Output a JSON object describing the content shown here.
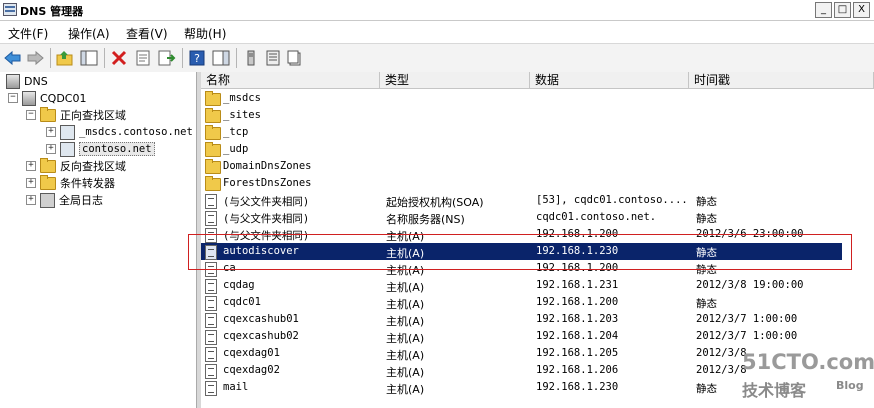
{
  "window": {
    "title": "DNS 管理器",
    "buttons": [
      "_",
      "□",
      "X"
    ]
  },
  "menu": [
    "文件(F)",
    "操作(A)",
    "查看(V)",
    "帮助(H)"
  ],
  "toolbar": [
    {
      "name": "back-arrow-icon"
    },
    {
      "name": "forward-arrow-icon"
    },
    {
      "name": "up-folder-icon"
    },
    {
      "name": "show-hide-tree-icon"
    },
    {
      "name": "delete-icon"
    },
    {
      "name": "properties-icon"
    },
    {
      "name": "export-list-icon"
    },
    {
      "name": "help-icon"
    },
    {
      "name": "show-action-pane-icon"
    },
    {
      "name": "server-icon"
    },
    {
      "name": "list-view-icon"
    },
    {
      "name": "zone-icon"
    }
  ],
  "tree": {
    "root": "DNS",
    "server": "CQDC01",
    "forward_zones": "正向查找区域",
    "zone_msdcs": "_msdcs.contoso.net",
    "zone_contoso": "contoso.net",
    "reverse_zones": "反向查找区域",
    "forwarders": "条件转发器",
    "global_logs": "全局日志"
  },
  "table": {
    "columns": [
      "名称",
      "类型",
      "数据",
      "时间戳"
    ],
    "rows": [
      {
        "icon": "folder",
        "name": "_msdcs",
        "type": "",
        "data": "",
        "time": ""
      },
      {
        "icon": "folder",
        "name": "_sites",
        "type": "",
        "data": "",
        "time": ""
      },
      {
        "icon": "folder",
        "name": "_tcp",
        "type": "",
        "data": "",
        "time": ""
      },
      {
        "icon": "folder",
        "name": "_udp",
        "type": "",
        "data": "",
        "time": ""
      },
      {
        "icon": "folder",
        "name": "DomainDnsZones",
        "type": "",
        "data": "",
        "time": ""
      },
      {
        "icon": "folder",
        "name": "ForestDnsZones",
        "type": "",
        "data": "",
        "time": ""
      },
      {
        "icon": "record",
        "name": "(与父文件夹相同)",
        "type": "起始授权机构(SOA)",
        "data": "[53], cqdc01.contoso....",
        "time": "静态"
      },
      {
        "icon": "record",
        "name": "(与父文件夹相同)",
        "type": "名称服务器(NS)",
        "data": "cqdc01.contoso.net.",
        "time": "静态"
      },
      {
        "icon": "record",
        "name": "(与父文件夹相同)",
        "type": "主机(A)",
        "data": "192.168.1.200",
        "time": "2012/3/6 23:00:00"
      },
      {
        "icon": "record",
        "name": "autodiscover",
        "type": "主机(A)",
        "data": "192.168.1.230",
        "time": "静态"
      },
      {
        "icon": "record",
        "name": "ca",
        "type": "主机(A)",
        "data": "192.168.1.200",
        "time": "静态"
      },
      {
        "icon": "record",
        "name": "cqdag",
        "type": "主机(A)",
        "data": "192.168.1.231",
        "time": "2012/3/8 19:00:00"
      },
      {
        "icon": "record",
        "name": "cqdc01",
        "type": "主机(A)",
        "data": "192.168.1.200",
        "time": "静态"
      },
      {
        "icon": "record",
        "name": "cqexcashub01",
        "type": "主机(A)",
        "data": "192.168.1.203",
        "time": "2012/3/7 1:00:00"
      },
      {
        "icon": "record",
        "name": "cqexcashub02",
        "type": "主机(A)",
        "data": "192.168.1.204",
        "time": "2012/3/7 1:00:00"
      },
      {
        "icon": "record",
        "name": "cqexdag01",
        "type": "主机(A)",
        "data": "192.168.1.205",
        "time": "2012/3/8"
      },
      {
        "icon": "record",
        "name": "cqexdag02",
        "type": "主机(A)",
        "data": "192.168.1.206",
        "time": "2012/3/8"
      },
      {
        "icon": "record",
        "name": "mail",
        "type": "主机(A)",
        "data": "192.168.1.230",
        "time": "静态"
      }
    ],
    "selected_row": 9
  },
  "watermark": {
    "main": "51CTO.com",
    "sub": "技术博客",
    "blog": "Blog"
  },
  "colors": {
    "selection": "#0a246a",
    "highlight_box": "#d02020"
  }
}
